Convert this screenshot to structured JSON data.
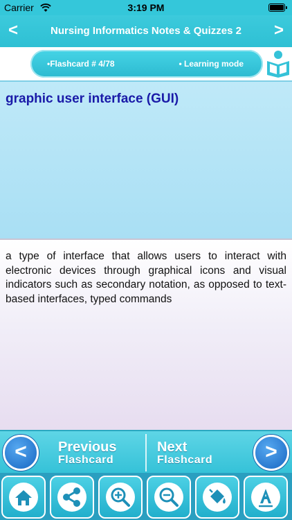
{
  "status_bar": {
    "carrier": "Carrier",
    "time": "3:19 PM"
  },
  "nav": {
    "title": "Nursing Informatics Notes & Quizzes 2",
    "back_icon": "chevron-left-icon",
    "forward_icon": "chevron-right-icon"
  },
  "info_bar": {
    "flashcard_label": "•Flashcard #  4/78",
    "mode_label": "• Learning mode",
    "mode_icon": "reading-person-icon"
  },
  "card": {
    "term": "graphic user interface (GUI)",
    "definition": "a type of interface that allows users to interact with electronic devices through graphical icons and visual indicators such as secondary notation, as opposed to text-based interfaces, typed commands"
  },
  "flip_bar": {
    "previous_line1": "Previous",
    "previous_line2": "Flashcard",
    "next_line1": "Next",
    "next_line2": "Flashcard"
  },
  "toolbar": {
    "items": [
      {
        "icon": "home-icon"
      },
      {
        "icon": "share-icon"
      },
      {
        "icon": "zoom-in-icon"
      },
      {
        "icon": "zoom-out-icon"
      },
      {
        "icon": "paint-bucket-icon"
      },
      {
        "icon": "font-icon"
      }
    ]
  },
  "colors": {
    "header": "#34c7da",
    "term_text": "#1a1aa8",
    "circle_button": "#1766c2"
  }
}
